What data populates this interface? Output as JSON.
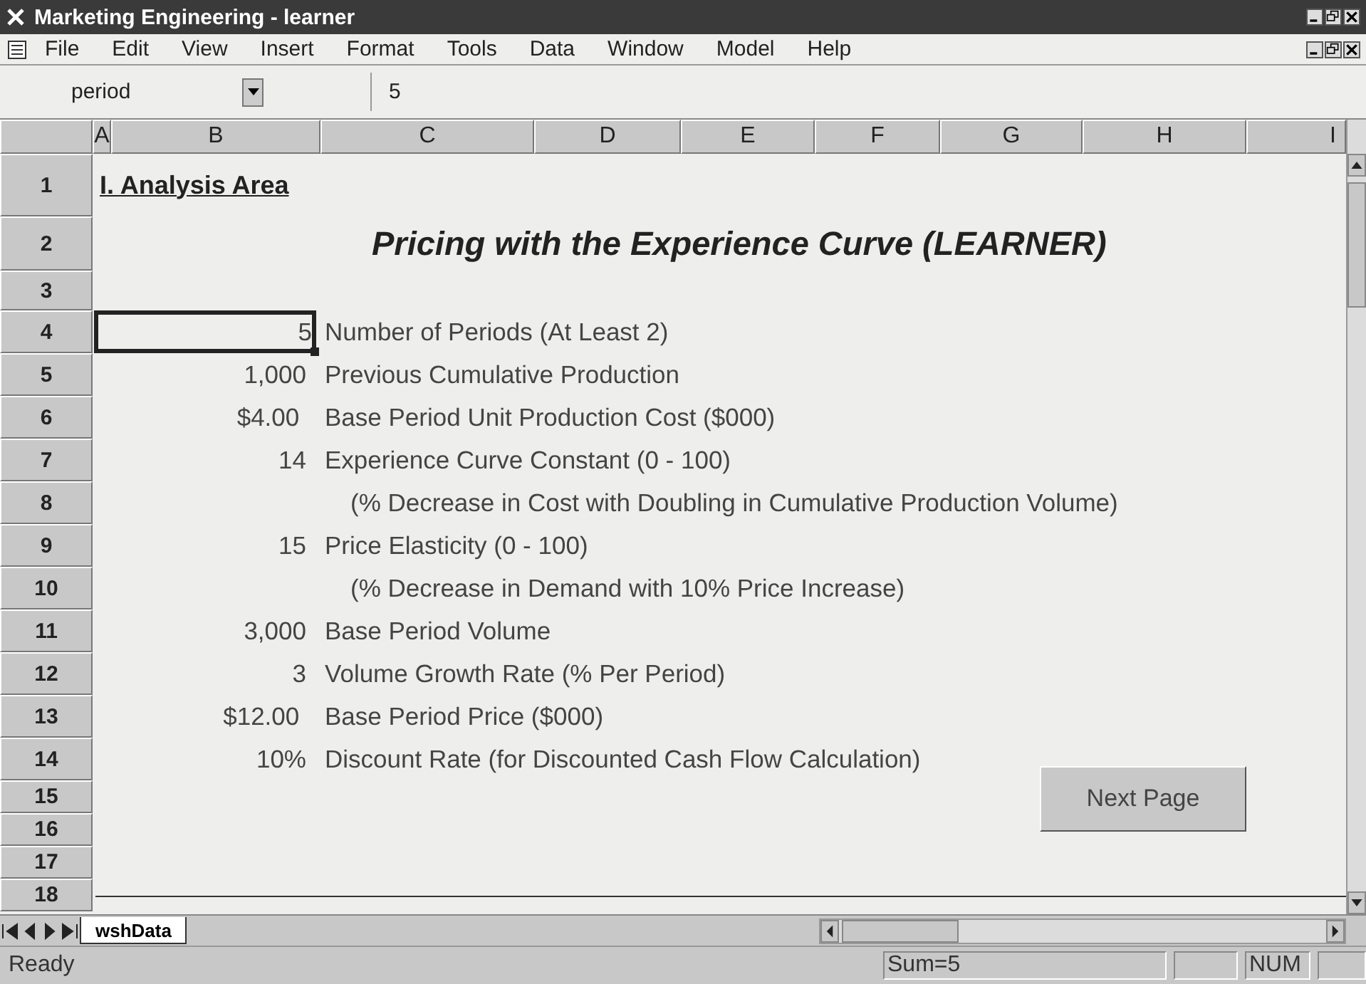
{
  "window": {
    "title": "Marketing Engineering - learner"
  },
  "menu": [
    "File",
    "Edit",
    "View",
    "Insert",
    "Format",
    "Tools",
    "Data",
    "Window",
    "Model",
    "Help"
  ],
  "name_box": "period",
  "formula": "5",
  "columns": [
    "A",
    "B",
    "C",
    "D",
    "E",
    "F",
    "G",
    "H",
    "I"
  ],
  "rows": [
    {
      "number": "1",
      "kind": "heading",
      "heading": "I. Analysis Area"
    },
    {
      "number": "2",
      "kind": "title",
      "title": "Pricing with the Experience Curve (LEARNER)"
    },
    {
      "number": "3",
      "kind": "blank"
    },
    {
      "number": "4",
      "kind": "input",
      "value": "5",
      "label": "Number of Periods (At Least 2)",
      "selected": true
    },
    {
      "number": "5",
      "kind": "input",
      "value": "1,000",
      "label": "Previous Cumulative Production",
      "selected": false
    },
    {
      "number": "6",
      "kind": "input",
      "value": "$4.00 ",
      "label": "Base Period Unit Production Cost ($000)",
      "selected": false
    },
    {
      "number": "7",
      "kind": "input",
      "value": "14",
      "label": "Experience Curve Constant (0 - 100)",
      "selected": false
    },
    {
      "number": "8",
      "kind": "note",
      "note": "(% Decrease in Cost with Doubling in Cumulative Production Volume)"
    },
    {
      "number": "9",
      "kind": "input",
      "value": "15",
      "label": "Price Elasticity (0 - 100)",
      "selected": false
    },
    {
      "number": "10",
      "kind": "note",
      "note": "(% Decrease in Demand with 10% Price Increase)"
    },
    {
      "number": "11",
      "kind": "input",
      "value": "3,000",
      "label": "Base Period Volume",
      "selected": false
    },
    {
      "number": "12",
      "kind": "input",
      "value": "3",
      "label": "Volume Growth Rate (% Per Period)",
      "selected": false
    },
    {
      "number": "13",
      "kind": "input",
      "value": "$12.00 ",
      "label": "Base Period Price ($000)",
      "selected": false
    },
    {
      "number": "14",
      "kind": "input",
      "value": "10%",
      "label": "Discount Rate (for Discounted Cash Flow Calculation)",
      "selected": false
    },
    {
      "number": "15",
      "kind": "button",
      "button": "Next Page"
    },
    {
      "number": "16",
      "kind": "blank"
    },
    {
      "number": "17",
      "kind": "blank"
    },
    {
      "number": "18",
      "kind": "blank"
    }
  ],
  "sheet_tabs": [
    {
      "label": "wshData",
      "selected": true
    }
  ],
  "status": {
    "text": "Ready",
    "sum": "Sum=5",
    "num": "NUM"
  }
}
